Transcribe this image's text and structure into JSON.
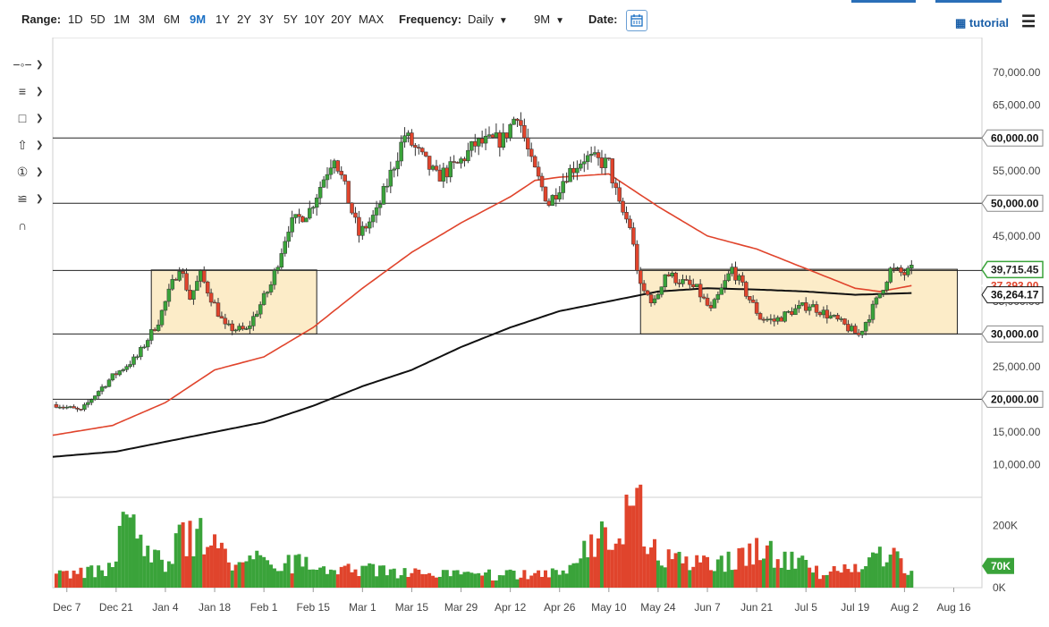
{
  "toolbar": {
    "range_label": "Range:",
    "ranges": [
      "1D",
      "5D",
      "1M",
      "3M",
      "6M",
      "9M",
      "1Y",
      "2Y",
      "3Y",
      "5Y",
      "10Y",
      "20Y",
      "MAX"
    ],
    "active_range": "9M",
    "frequency_label": "Frequency:",
    "frequency_value": "Daily",
    "period_value": "9M",
    "date_label": "Date:",
    "tutorial_label": "tutorial"
  },
  "side_tools": [
    "line-tool",
    "fib-tool",
    "rect-tool",
    "arrow-tool",
    "count-tool",
    "pitchfork-tool",
    "magnet-tool"
  ],
  "colors": {
    "up": "#3aa33a",
    "down": "#e0442c",
    "ma_short": "#e0442c",
    "ma_long": "#111111",
    "box_fill": "#fcecc8",
    "box_stroke": "#222222",
    "accent": "#1a6fc4"
  },
  "chart_data": {
    "type": "candlestick",
    "ylim": [
      5000,
      74000
    ],
    "y_ticks": [
      {
        "v": 70000,
        "label": "70,000.00"
      },
      {
        "v": 65000,
        "label": "65,000.00"
      },
      {
        "v": 55000,
        "label": "55,000.00"
      },
      {
        "v": 45000,
        "label": "45,000.00"
      },
      {
        "v": 35000,
        "label": "35,000.00"
      },
      {
        "v": 25000,
        "label": "25,000.00"
      },
      {
        "v": 15000,
        "label": "15,000.00"
      },
      {
        "v": 10000,
        "label": "10,000.00"
      }
    ],
    "x_axis": {
      "start_date": "2020-12-03",
      "end_date": "2021-08-24",
      "ticks": [
        {
          "date": "2020-12-07",
          "label": "Dec 7"
        },
        {
          "date": "2020-12-21",
          "label": "Dec 21"
        },
        {
          "date": "2021-01-04",
          "label": "Jan 4"
        },
        {
          "date": "2021-01-18",
          "label": "Jan 18"
        },
        {
          "date": "2021-02-01",
          "label": "Feb 1"
        },
        {
          "date": "2021-02-15",
          "label": "Feb 15"
        },
        {
          "date": "2021-03-01",
          "label": "Mar 1"
        },
        {
          "date": "2021-03-15",
          "label": "Mar 15"
        },
        {
          "date": "2021-03-29",
          "label": "Mar 29"
        },
        {
          "date": "2021-04-12",
          "label": "Apr 12"
        },
        {
          "date": "2021-04-26",
          "label": "Apr 26"
        },
        {
          "date": "2021-05-10",
          "label": "May 10"
        },
        {
          "date": "2021-05-24",
          "label": "May 24"
        },
        {
          "date": "2021-06-07",
          "label": "Jun 7"
        },
        {
          "date": "2021-06-21",
          "label": "Jun 21"
        },
        {
          "date": "2021-07-05",
          "label": "Jul 5"
        },
        {
          "date": "2021-07-19",
          "label": "Jul 19"
        },
        {
          "date": "2021-08-02",
          "label": "Aug 2"
        },
        {
          "date": "2021-08-16",
          "label": "Aug 16"
        }
      ]
    },
    "price_path": {
      "start_date": "2020-12-04",
      "end_date": "2021-08-04",
      "anchors": [
        {
          "date": "2020-12-04",
          "close": 19200
        },
        {
          "date": "2020-12-11",
          "close": 18200
        },
        {
          "date": "2020-12-16",
          "close": 21300
        },
        {
          "date": "2020-12-20",
          "close": 23500
        },
        {
          "date": "2020-12-27",
          "close": 26500
        },
        {
          "date": "2021-01-02",
          "close": 32000
        },
        {
          "date": "2021-01-08",
          "close": 40500
        },
        {
          "date": "2021-01-11",
          "close": 35500
        },
        {
          "date": "2021-01-14",
          "close": 39000
        },
        {
          "date": "2021-01-21",
          "close": 31000
        },
        {
          "date": "2021-01-27",
          "close": 30500
        },
        {
          "date": "2021-02-03",
          "close": 37500
        },
        {
          "date": "2021-02-08",
          "close": 46500
        },
        {
          "date": "2021-02-14",
          "close": 49000
        },
        {
          "date": "2021-02-21",
          "close": 57500
        },
        {
          "date": "2021-02-28",
          "close": 45200
        },
        {
          "date": "2021-03-05",
          "close": 48500
        },
        {
          "date": "2021-03-13",
          "close": 60500
        },
        {
          "date": "2021-03-22",
          "close": 54000
        },
        {
          "date": "2021-03-28",
          "close": 55900
        },
        {
          "date": "2021-04-02",
          "close": 59000
        },
        {
          "date": "2021-04-10",
          "close": 59800
        },
        {
          "date": "2021-04-14",
          "close": 64000
        },
        {
          "date": "2021-04-18",
          "close": 56000
        },
        {
          "date": "2021-04-23",
          "close": 50000
        },
        {
          "date": "2021-04-28",
          "close": 54500
        },
        {
          "date": "2021-05-03",
          "close": 57000
        },
        {
          "date": "2021-05-10",
          "close": 56000
        },
        {
          "date": "2021-05-13",
          "close": 49500
        },
        {
          "date": "2021-05-16",
          "close": 46500
        },
        {
          "date": "2021-05-19",
          "close": 37000
        },
        {
          "date": "2021-05-23",
          "close": 34800
        },
        {
          "date": "2021-05-26",
          "close": 39300
        },
        {
          "date": "2021-06-04",
          "close": 36800
        },
        {
          "date": "2021-06-08",
          "close": 33500
        },
        {
          "date": "2021-06-14",
          "close": 40000
        },
        {
          "date": "2021-06-22",
          "close": 32500
        },
        {
          "date": "2021-06-26",
          "close": 32000
        },
        {
          "date": "2021-07-01",
          "close": 33500
        },
        {
          "date": "2021-07-06",
          "close": 34500
        },
        {
          "date": "2021-07-14",
          "close": 32000
        },
        {
          "date": "2021-07-20",
          "close": 29800
        },
        {
          "date": "2021-07-25",
          "close": 35000
        },
        {
          "date": "2021-07-29",
          "close": 39800
        },
        {
          "date": "2021-08-02",
          "close": 39200
        },
        {
          "date": "2021-08-04",
          "close": 39715
        }
      ]
    },
    "ma_short_path": [
      {
        "date": "2020-12-03",
        "v": 14500
      },
      {
        "date": "2020-12-20",
        "v": 16000
      },
      {
        "date": "2021-01-04",
        "v": 19500
      },
      {
        "date": "2021-01-18",
        "v": 24500
      },
      {
        "date": "2021-02-01",
        "v": 26500
      },
      {
        "date": "2021-02-15",
        "v": 31000
      },
      {
        "date": "2021-03-01",
        "v": 37000
      },
      {
        "date": "2021-03-15",
        "v": 42500
      },
      {
        "date": "2021-03-29",
        "v": 47000
      },
      {
        "date": "2021-04-12",
        "v": 51000
      },
      {
        "date": "2021-04-19",
        "v": 53500
      },
      {
        "date": "2021-04-26",
        "v": 54000
      },
      {
        "date": "2021-05-10",
        "v": 54500
      },
      {
        "date": "2021-05-17",
        "v": 52000
      },
      {
        "date": "2021-05-24",
        "v": 49500
      },
      {
        "date": "2021-06-07",
        "v": 45000
      },
      {
        "date": "2021-06-21",
        "v": 43000
      },
      {
        "date": "2021-07-05",
        "v": 40000
      },
      {
        "date": "2021-07-19",
        "v": 37000
      },
      {
        "date": "2021-07-26",
        "v": 36500
      },
      {
        "date": "2021-08-04",
        "v": 37400
      }
    ],
    "ma_long_path": [
      {
        "date": "2020-12-03",
        "v": 11200
      },
      {
        "date": "2020-12-21",
        "v": 12000
      },
      {
        "date": "2021-01-04",
        "v": 13500
      },
      {
        "date": "2021-01-18",
        "v": 15000
      },
      {
        "date": "2021-02-01",
        "v": 16500
      },
      {
        "date": "2021-02-15",
        "v": 19000
      },
      {
        "date": "2021-03-01",
        "v": 22000
      },
      {
        "date": "2021-03-15",
        "v": 24500
      },
      {
        "date": "2021-03-29",
        "v": 28000
      },
      {
        "date": "2021-04-12",
        "v": 31000
      },
      {
        "date": "2021-04-26",
        "v": 33500
      },
      {
        "date": "2021-05-10",
        "v": 35000
      },
      {
        "date": "2021-05-24",
        "v": 36500
      },
      {
        "date": "2021-06-07",
        "v": 37000
      },
      {
        "date": "2021-06-21",
        "v": 36800
      },
      {
        "date": "2021-07-05",
        "v": 36500
      },
      {
        "date": "2021-07-19",
        "v": 36000
      },
      {
        "date": "2021-08-04",
        "v": 36264
      }
    ],
    "horizontal_levels": [
      {
        "v": 60000,
        "label": "60,000.00"
      },
      {
        "v": 50000,
        "label": "50,000.00"
      },
      {
        "v": 30000,
        "label": "30,000.00"
      },
      {
        "v": 20000,
        "label": "20,000.00"
      },
      {
        "v": 39715,
        "label": ""
      }
    ],
    "boxes": [
      {
        "start": "2020-12-31",
        "end": "2021-02-16",
        "low": 30000,
        "high": 39800
      },
      {
        "start": "2021-05-19",
        "end": "2021-08-17",
        "low": 30000,
        "high": 39900
      }
    ],
    "price_tags": [
      {
        "v": 39715.45,
        "label": "39,715.45",
        "color": "#3aa33a",
        "text_color": "#222222"
      },
      {
        "v": 37392.0,
        "label": "37,393.00",
        "color": "#e0442c",
        "text_color": "#e0442c"
      },
      {
        "v": 36264.17,
        "label": "36,264.17",
        "color": "#111111",
        "text_color": "#ffffff"
      }
    ],
    "volume": {
      "ylim": [
        0,
        280000
      ],
      "ticks": [
        {
          "v": 200000,
          "label": "200K"
        },
        {
          "v": 0,
          "label": "0K"
        }
      ],
      "current": {
        "v": 70000,
        "label": "70K"
      },
      "anchors": [
        {
          "date": "2020-12-04",
          "v": 38000
        },
        {
          "date": "2020-12-20",
          "v": 60000
        },
        {
          "date": "2020-12-23",
          "v": 200000
        },
        {
          "date": "2021-01-04",
          "v": 75000
        },
        {
          "date": "2021-01-11",
          "v": 190000
        },
        {
          "date": "2021-01-21",
          "v": 90000
        },
        {
          "date": "2021-02-08",
          "v": 80000
        },
        {
          "date": "2021-02-20",
          "v": 60000
        },
        {
          "date": "2021-03-10",
          "v": 55000
        },
        {
          "date": "2021-04-01",
          "v": 38000
        },
        {
          "date": "2021-04-25",
          "v": 50000
        },
        {
          "date": "2021-05-19",
          "v": 260000
        },
        {
          "date": "2021-05-24",
          "v": 90000
        },
        {
          "date": "2021-06-08",
          "v": 70000
        },
        {
          "date": "2021-06-22",
          "v": 130000
        },
        {
          "date": "2021-07-10",
          "v": 45000
        },
        {
          "date": "2021-07-22",
          "v": 60000
        },
        {
          "date": "2021-07-26",
          "v": 110000
        },
        {
          "date": "2021-08-04",
          "v": 70000
        }
      ]
    }
  }
}
